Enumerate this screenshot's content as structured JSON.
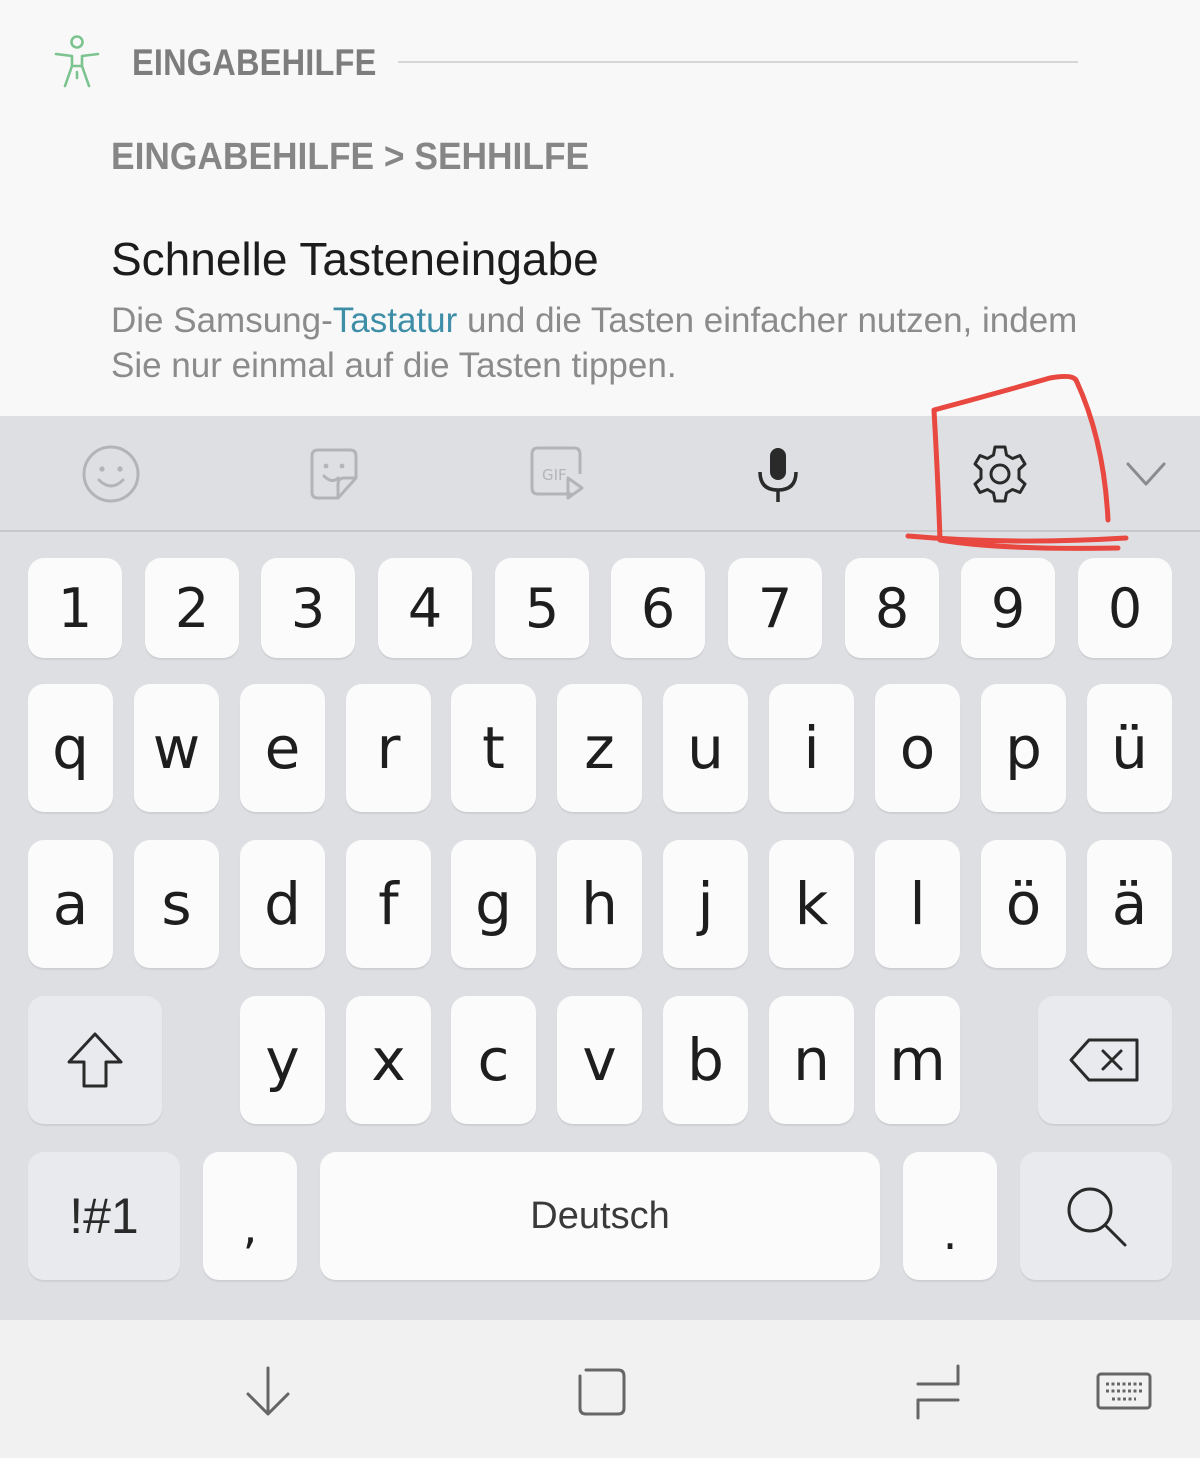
{
  "section": {
    "title": "EINGABEHILFE"
  },
  "result": {
    "breadcrumb": "EINGABEHILFE > SEHHILFE",
    "title": "Schnelle Tasteneingabe",
    "desc_before": "Die Samsung-",
    "desc_link": "Tastatur",
    "desc_after": " und die Tasten einfacher nutzen, indem Sie nur einmal auf die Tasten tippen."
  },
  "toolbar": {
    "icons": [
      "emoji-icon",
      "sticker-icon",
      "gif-icon",
      "microphone-icon",
      "settings-gear-icon",
      "chevron-down-icon"
    ],
    "gif_label": "GIF",
    "highlighted": "settings-gear-icon"
  },
  "keyboard": {
    "row_numbers": [
      "1",
      "2",
      "3",
      "4",
      "5",
      "6",
      "7",
      "8",
      "9",
      "0"
    ],
    "row1": [
      "q",
      "w",
      "e",
      "r",
      "t",
      "z",
      "u",
      "i",
      "o",
      "p",
      "ü"
    ],
    "row2": [
      "a",
      "s",
      "d",
      "f",
      "g",
      "h",
      "j",
      "k",
      "l",
      "ö",
      "ä"
    ],
    "row3": [
      "y",
      "x",
      "c",
      "v",
      "b",
      "n",
      "m"
    ],
    "symbols_label": "!#1",
    "comma": ",",
    "space_label": "Deutsch",
    "period": ".",
    "annotation_color": "#e8483f"
  },
  "navbar": {
    "icons": [
      "hide-keyboard-icon",
      "home-icon",
      "recents-icon",
      "keyboard-switch-icon"
    ]
  }
}
